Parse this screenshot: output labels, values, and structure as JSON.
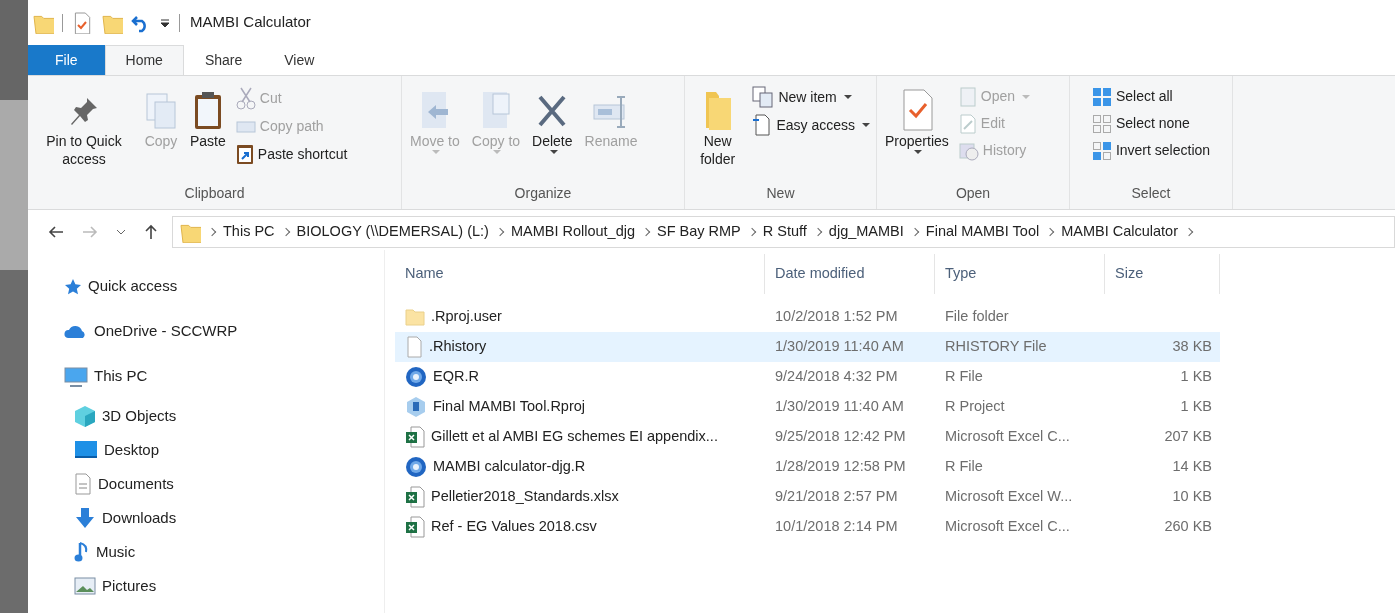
{
  "window": {
    "title": "MAMBI Calculator"
  },
  "tabs": [
    {
      "label": "File",
      "selected": false,
      "kind": "file"
    },
    {
      "label": "Home",
      "selected": true,
      "kind": "tab"
    },
    {
      "label": "Share",
      "selected": false,
      "kind": "tab"
    },
    {
      "label": "View",
      "selected": false,
      "kind": "tab"
    }
  ],
  "ribbon": {
    "groups": [
      {
        "label": "Clipboard",
        "items": [
          {
            "kind": "large",
            "label": "Pin to Quick access",
            "disabled": false,
            "dropdown": false
          },
          {
            "kind": "large",
            "label": "Copy",
            "disabled": true,
            "dropdown": false
          },
          {
            "kind": "large",
            "label": "Paste",
            "disabled": false,
            "dropdown": false
          },
          {
            "kind": "stack",
            "items": [
              {
                "label": "Cut",
                "disabled": true,
                "dropdown": false
              },
              {
                "label": "Copy path",
                "disabled": true,
                "dropdown": false
              },
              {
                "label": "Paste shortcut",
                "disabled": false,
                "dropdown": false
              }
            ]
          }
        ]
      },
      {
        "label": "Organize",
        "items": [
          {
            "kind": "large",
            "label": "Move to",
            "disabled": true,
            "dropdown": true
          },
          {
            "kind": "large",
            "label": "Copy to",
            "disabled": true,
            "dropdown": true
          },
          {
            "kind": "large",
            "label": "Delete",
            "disabled": false,
            "dropdown": true
          },
          {
            "kind": "large",
            "label": "Rename",
            "disabled": true,
            "dropdown": false
          }
        ]
      },
      {
        "label": "New",
        "items": [
          {
            "kind": "large",
            "label": "New folder",
            "disabled": false,
            "dropdown": false
          },
          {
            "kind": "stack",
            "items": [
              {
                "label": "New item",
                "disabled": false,
                "dropdown": true
              },
              {
                "label": "Easy access",
                "disabled": false,
                "dropdown": true
              }
            ]
          }
        ]
      },
      {
        "label": "Open",
        "items": [
          {
            "kind": "large",
            "label": "Properties",
            "disabled": false,
            "dropdown": true
          },
          {
            "kind": "stack",
            "items": [
              {
                "label": "Open",
                "disabled": true,
                "dropdown": true
              },
              {
                "label": "Edit",
                "disabled": true,
                "dropdown": false
              },
              {
                "label": "History",
                "disabled": true,
                "dropdown": false
              }
            ]
          }
        ]
      },
      {
        "label": "Select",
        "items": [
          {
            "kind": "stack",
            "items": [
              {
                "label": "Select all",
                "disabled": false,
                "dropdown": false
              },
              {
                "label": "Select none",
                "disabled": false,
                "dropdown": false
              },
              {
                "label": "Invert selection",
                "disabled": false,
                "dropdown": false
              }
            ]
          }
        ]
      }
    ]
  },
  "address_bar": {
    "path": [
      "This PC",
      "BIOLOGY (\\\\DEMERSAL) (L:)",
      "MAMBI Rollout_djg",
      "SF Bay RMP",
      "R Stuff",
      "djg_MAMBI",
      "Final MAMBI Tool",
      "MAMBI Calculator"
    ]
  },
  "navigation_pane": {
    "items": [
      {
        "label": "Quick access"
      },
      {
        "label": "OneDrive - SCCWRP"
      },
      {
        "label": "This PC",
        "children": [
          {
            "label": "3D Objects"
          },
          {
            "label": "Desktop"
          },
          {
            "label": "Documents"
          },
          {
            "label": "Downloads"
          },
          {
            "label": "Music"
          },
          {
            "label": "Pictures"
          }
        ]
      }
    ]
  },
  "file_list": {
    "columns": [
      "Name",
      "Date modified",
      "Type",
      "Size"
    ],
    "rows": [
      {
        "kind": "folder",
        "name": ".Rproj.user",
        "date": "10/2/2018 1:52 PM",
        "type": "File folder",
        "selected": false
      },
      {
        "kind": "file",
        "name": ".Rhistory",
        "date": "1/30/2019 11:40 AM",
        "type": "RHISTORY File",
        "size": "38 KB",
        "selected": true
      },
      {
        "kind": "r",
        "name": "EQR.R",
        "date": "9/24/2018 4:32 PM",
        "type": "R File",
        "size": "1 KB",
        "selected": false
      },
      {
        "kind": "rproj",
        "name": "Final MAMBI Tool.Rproj",
        "date": "1/30/2019 11:40 AM",
        "type": "R Project",
        "size": "1 KB",
        "selected": false
      },
      {
        "kind": "excel",
        "name": "Gillett et al AMBI EG schemes EI appendix...",
        "date": "9/25/2018 12:42 PM",
        "type": "Microsoft Excel C...",
        "size": "207 KB",
        "selected": false
      },
      {
        "kind": "r",
        "name": "MAMBI calculator-djg.R",
        "date": "1/28/2019 12:58 PM",
        "type": "R File",
        "size": "14 KB",
        "selected": false
      },
      {
        "kind": "excel",
        "name": "Pelletier2018_Standards.xlsx",
        "date": "9/21/2018 2:57 PM",
        "type": "Microsoft Excel W...",
        "size": "10 KB",
        "selected": false
      },
      {
        "kind": "excel",
        "name": "Ref - EG Values 2018.csv",
        "date": "10/1/2018 2:14 PM",
        "type": "Microsoft Excel C...",
        "size": "260 KB",
        "selected": false
      }
    ]
  }
}
